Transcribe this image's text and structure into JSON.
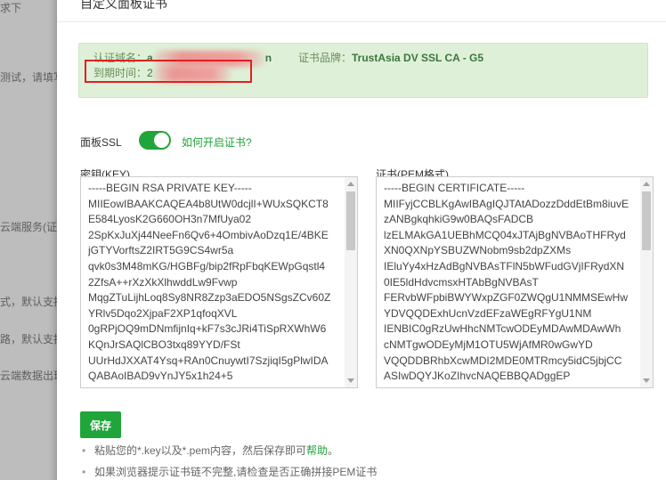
{
  "background": {
    "snippets": [
      "求下",
      "测试，请填写",
      "云端服务(证书",
      "式，默认支持",
      "路，默认支持",
      "云端数据出现"
    ]
  },
  "modal": {
    "title": "自定义面板证书",
    "cert_info": {
      "domain_label": "认证域名：",
      "domain_prefix": "a",
      "domain_suffix": "n",
      "expire_label": "到期时间：",
      "expire_prefix": "2",
      "brand_label": "证书品牌：",
      "brand_value": "TrustAsia DV SSL CA - G5"
    },
    "ssl": {
      "label": "面板SSL",
      "enabled": true,
      "help_link": "如何开启证书?"
    },
    "key_field": {
      "label": "密钥(KEY)",
      "lines": [
        "-----BEGIN RSA PRIVATE KEY-----",
        "MIIEowIBAAKCAQEA4b8UtW0dcjlI+WUxSQKCT8",
        "E584LyosK2G660OH3n7MfUya02",
        "2SpKxJuXj44NeeFn6Qv6+4OmbivAoDzq1E/4BKE",
        "jGTYVorftsZ2IRT5G9CS4wr5a",
        "qvk0s3M48mKG/HGBFg/bip2fRpFbqKEWpGqstl4",
        "2ZfsA++rXzXkXlhwddLw9Fvwp",
        "MqgZTuLijhLoq8Sy8NR8Zzp3aEDO5NSgsZCv60Z",
        "YRlv5Dqo2XjpaF2XP1qfoqXVL",
        "0gRPjOQ9mDNmfijnIq+kF7s3cJRi4TiSpRXWhW6",
        "KQnJrSAQlCBO3txq89YYD/FSt",
        "UUrHdJXXAT4Ysq+RAn0CnuywtI7SzjiqI5gPlwIDA",
        "QABAoIBAD9vYnJY5x1h24+5"
      ]
    },
    "cert_field": {
      "label": "证书(PEM格式)",
      "lines": [
        "-----BEGIN CERTIFICATE-----",
        "MIIFyjCCBLKgAwIBAgIQJTAtADozzDddEtBm8iuvE",
        "zANBgkqhkiG9w0BAQsFADCB",
        "lzELMAkGA1UEBhMCQ04xJTAjBgNVBAoTHFRyd",
        "XN0QXNpYSBUZWNobm9sb2dpZXMs",
        "IEluYy4xHzAdBgNVBAsTFlN5bWFudGVjIFRydXN",
        "0IE5ldHdvcmsxHTAbBgNVBAsT",
        "FERvbWFpbiBWYWxpZGF0ZWQgU1NMMSEwHw",
        "YDVQQDExhUcnVzdEFzaWEgRFYgU1NM",
        "IENBIC0gRzUwHhcNMTcwODEyMDAwMDAwWh",
        "cNMTgwODEyMjM1OTU5WjAfMR0wGwYD",
        "VQQDDBRhbXcwMDI2MDE0MTRmcy5idC5jbjCC",
        "ASIwDQYJKoZIhvcNAQEBBQADggEP"
      ]
    },
    "save_label": "保存",
    "notes": {
      "note1_text": "粘贴您的*.key以及*.pem内容，然后保存即可",
      "note1_link": "帮助",
      "note1_end": "。",
      "note2_text": "如果浏览器提示证书链不完整,请检查是否正确拼接PEM证书"
    }
  }
}
